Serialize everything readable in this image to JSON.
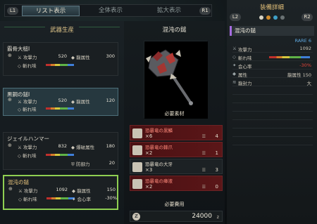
{
  "topbar": {
    "left_button": "L1",
    "right_button": "R1",
    "tabs": [
      "リスト表示",
      "全体表示",
      "拡大表示"
    ]
  },
  "left": {
    "header": "武器生産",
    "cards": [
      {
        "name": "霸骨大槌Ⅰ",
        "attack_label": "攻撃力",
        "attack": "520",
        "elem_label": "龍属性",
        "elem": "300",
        "sharp_label": "斬れ味"
      },
      {
        "name": "黒鋼の鎚Ⅰ",
        "attack_label": "攻撃力",
        "attack": "520",
        "elem_label": "龍属性",
        "elem": "120",
        "sharp_label": "斬れ味"
      },
      {
        "name": "ジェイルハンマー",
        "attack_label": "攻撃力",
        "attack": "832",
        "elem_label": "爆破属性",
        "elem": "180",
        "sharp_label": "斬れ味",
        "def_label": "防御力",
        "def": "20"
      },
      {
        "name": "混沌の鎚",
        "attack_label": "攻撃力",
        "attack": "1092",
        "elem_label": "龍属性",
        "elem": "150",
        "sharp_label": "斬れ味",
        "aff_label": "会心率",
        "aff": "-30%"
      }
    ]
  },
  "center": {
    "title": "混沌の鎚",
    "materials_label": "必要素材",
    "materials": [
      {
        "name": "恐暴竜の黒鱗",
        "need": "×6",
        "own": "4",
        "lack": true
      },
      {
        "name": "恐暴竜の棘爪",
        "need": "×2",
        "own": "1",
        "lack": true
      },
      {
        "name": "恐暴竜の大牙",
        "need": "×3",
        "own": "3",
        "lack": false
      },
      {
        "name": "恐暴竜の瘴液",
        "need": "×2",
        "own": "0",
        "lack": true
      }
    ],
    "cost_label": "必要費用",
    "cost": "24000",
    "cost_unit": "z"
  },
  "right": {
    "title": "装備詳細",
    "l2": "L2",
    "r2": "R2",
    "weapon_name": "混沌の鎚",
    "rarity": "RARE 6",
    "rows": [
      {
        "icon": "⚔",
        "label": "攻撃力",
        "value": "1092"
      },
      {
        "icon": "◇",
        "label": "斬れ味",
        "value": ""
      },
      {
        "icon": "✦",
        "label": "会心率",
        "value": "-30%"
      },
      {
        "icon": "◆",
        "label": "属性",
        "value": "龍属性 150"
      },
      {
        "icon": "≋",
        "label": "龍封力",
        "value": "大"
      },
      {
        "icon": "",
        "label": "",
        "value": ""
      },
      {
        "icon": "",
        "label": "",
        "value": ""
      },
      {
        "icon": "",
        "label": "",
        "value": ""
      },
      {
        "icon": "",
        "label": "",
        "value": ""
      },
      {
        "icon": "",
        "label": "",
        "value": ""
      },
      {
        "icon": "",
        "label": "",
        "value": ""
      },
      {
        "icon": "",
        "label": "",
        "value": ""
      }
    ],
    "colors": {
      "accent": "#e5c27b",
      "dragon": "#a56ce0",
      "negative": "#e2443a",
      "selection": "#8fcf52"
    }
  }
}
